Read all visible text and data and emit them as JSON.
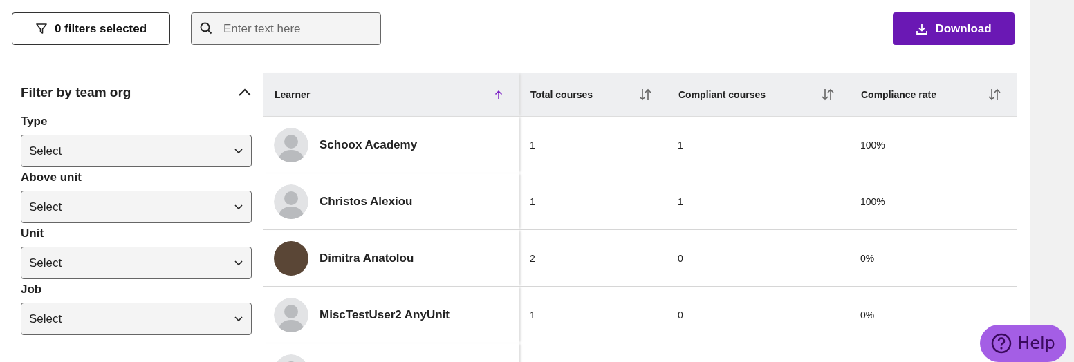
{
  "toolbar": {
    "filters_button": "0 filters selected",
    "search": {
      "placeholder": "Enter text here"
    },
    "download_button": "Download"
  },
  "sidebar": {
    "title": "Filter by team org",
    "expanded": true,
    "filters": [
      {
        "label": "Type",
        "value": "Select"
      },
      {
        "label": "Above unit",
        "value": "Select"
      },
      {
        "label": "Unit",
        "value": "Select"
      },
      {
        "label": "Job",
        "value": "Select"
      }
    ]
  },
  "table": {
    "columns": [
      {
        "label": "Learner",
        "sorted": true
      },
      {
        "label": "Total courses",
        "sorted": false
      },
      {
        "label": "Compliant courses",
        "sorted": false
      },
      {
        "label": "Compliance rate",
        "sorted": false
      }
    ],
    "rows": [
      {
        "has_photo": false,
        "name": "Schoox Academy",
        "total": "1",
        "compliant": "1",
        "rate": "100%"
      },
      {
        "has_photo": false,
        "name": "Christos Alexiou",
        "total": "1",
        "compliant": "1",
        "rate": "100%"
      },
      {
        "has_photo": true,
        "name": "Dimitra Anatolou",
        "total": "2",
        "compliant": "0",
        "rate": "0%"
      },
      {
        "has_photo": false,
        "name": "MiscTestUser2 AnyUnit",
        "total": "1",
        "compliant": "0",
        "rate": "0%"
      },
      {
        "has_photo": false
      }
    ]
  },
  "help_button": "Help"
}
